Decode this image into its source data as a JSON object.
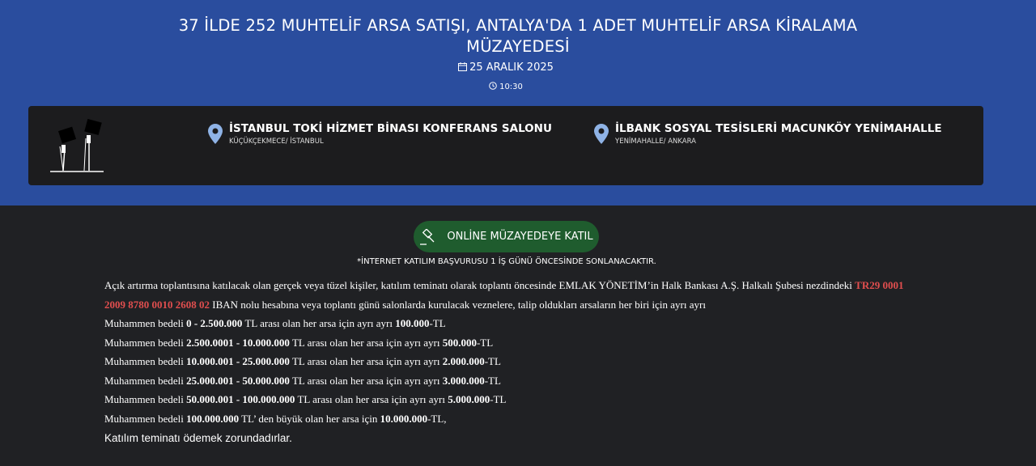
{
  "header": {
    "title": "37 İLDE 252 MUHTELİF ARSA SATIŞI, ANTALYA'DA 1 ADET MUHTELİF ARSA KİRALAMA MÜZAYEDESİ",
    "date": "25 ARALIK 2025",
    "time": "10:30",
    "date_icon": "calendar-icon",
    "time_icon": "clock-icon"
  },
  "venues": [
    {
      "name": "İSTANBUL TOKİ HİZMET BİNASI KONFERANS SALONU",
      "location": "KÜÇÜKÇEKMECE/ İSTANBUL",
      "icon": "map-pin-icon"
    },
    {
      "name": "İLBANK SOSYAL TESİSLERİ MACUNKÖY YENİMAHALLE",
      "location": "YENİMAHALLE/ ANKARA",
      "icon": "map-pin-icon"
    }
  ],
  "join_button": {
    "label": "ONLİNE MÜZAYEDEYE KATIL",
    "icon": "gavel-icon"
  },
  "notice": "*İNTERNET KATILIM BAŞVURUSU 1 İŞ GÜNÜ ÖNCESİNDE SONLANACAKTIR.",
  "info": {
    "intro_before": "Açık artırma toplantısına katılacak olan gerçek veya tüzel kişiler, katılım teminatı olarak toplantı öncesinde EMLAK YÖNETİM’in Halk Bankası A.Ş. Halkalı Şubesi nezdindeki ",
    "iban": "TR29 0001 2009 8780 0010 2608 02",
    "intro_after": " IBAN nolu hesabına veya toplantı günü salonlarda kurulacak veznelere, talip oldukları arsaların her biri için ayrı ayrı",
    "rows": [
      {
        "prefix": "Muhammen bedeli ",
        "range": "0 - 2.500.000",
        "middle": " TL arası olan her arsa için ayrı ayrı ",
        "amount": "100.000",
        "suffix": "-TL"
      },
      {
        "prefix": "Muhammen bedeli ",
        "range": "2.500.0001 - 10.000.000",
        "middle": " TL arası olan her arsa için ayrı ayrı ",
        "amount": "500.000",
        "suffix": "-TL"
      },
      {
        "prefix": "Muhammen bedeli ",
        "range": "10.000.001 - 25.000.000",
        "middle": " TL arası olan her arsa için ayrı ayrı ",
        "amount": "2.000.000",
        "suffix": "-TL"
      },
      {
        "prefix": "Muhammen bedeli ",
        "range": "25.000.001 - 50.000.000",
        "middle": " TL arası olan her arsa için ayrı ayrı ",
        "amount": "3.000.000",
        "suffix": "-TL"
      },
      {
        "prefix": "Muhammen bedeli ",
        "range": "50.000.001 - 100.000.000",
        "middle": " TL arası olan her arsa için ayrı ayrı ",
        "amount": "5.000.000",
        "suffix": "-TL"
      },
      {
        "prefix": "Muhammen bedeli ",
        "range": "100.000.000",
        "middle": " TL’ den büyük olan her arsa için ",
        "amount": "10.000.000",
        "suffix": "-TL,"
      }
    ],
    "closing": "Katılım teminatı ödemek zorundadırlar."
  },
  "colors": {
    "hero_bg": "#2a4d9e",
    "page_bg": "#202124",
    "card_bg": "#1c1c1e",
    "button_bg": "#1f5c2e",
    "iban_red": "#e04e4e",
    "pin_blue": "#8fb3e6"
  }
}
